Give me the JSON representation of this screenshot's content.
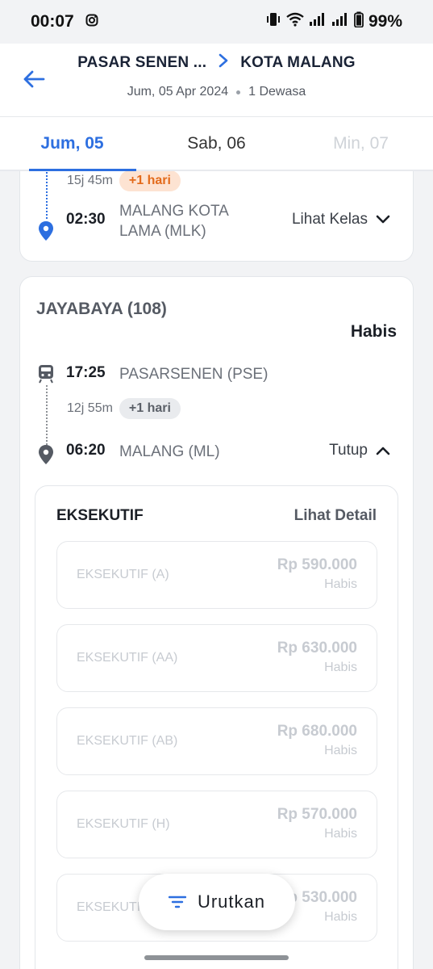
{
  "status_bar": {
    "time": "00:07",
    "battery": "99%"
  },
  "header": {
    "origin": "PASAR SENEN ...",
    "destination": "KOTA MALANG",
    "date": "Jum, 05 Apr 2024",
    "passengers": "1 Dewasa"
  },
  "date_tabs": [
    {
      "label": "Jum, 05",
      "state": "active"
    },
    {
      "label": "Sab, 06",
      "state": "normal"
    },
    {
      "label": "Min, 07",
      "state": "disabled"
    }
  ],
  "card1": {
    "duration": "15j 45m",
    "badge": "+1 hari",
    "arrival_time": "02:30",
    "arrival_station_line1": "MALANG KOTA",
    "arrival_station_line2": "LAMA (MLK)",
    "action_label": "Lihat Kelas"
  },
  "card2": {
    "train_name": "JAYABAYA (108)",
    "status": "Habis",
    "depart_time": "17:25",
    "depart_station": "PASARSENEN (PSE)",
    "duration": "12j 55m",
    "badge": "+1 hari",
    "arrival_time": "06:20",
    "arrival_station": "MALANG (ML)",
    "action_label": "Tutup",
    "class_section": {
      "title": "EKSEKUTIF",
      "detail_label": "Lihat Detail",
      "options": [
        {
          "name": "EKSEKUTIF (A)",
          "price": "Rp 590.000",
          "status": "Habis"
        },
        {
          "name": "EKSEKUTIF (AA)",
          "price": "Rp 630.000",
          "status": "Habis"
        },
        {
          "name": "EKSEKUTIF (AB)",
          "price": "Rp 680.000",
          "status": "Habis"
        },
        {
          "name": "EKSEKUTIF (H)",
          "price": "Rp 570.000",
          "status": "Habis"
        },
        {
          "name": "EKSEKUTIF",
          "price": "Rp 530.000",
          "status": "Habis"
        }
      ]
    }
  },
  "sort_button": {
    "label": "Urutkan"
  },
  "colors": {
    "accent": "#2d6fe0",
    "badge_orange_bg": "#fde3d2",
    "badge_orange_text": "#e36b1c"
  }
}
